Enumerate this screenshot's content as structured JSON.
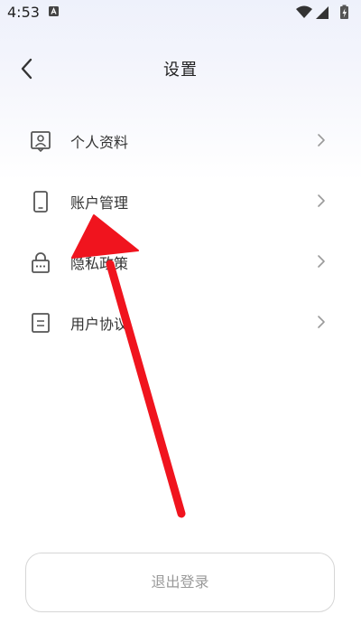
{
  "status_bar": {
    "time": "4:53",
    "icons": [
      "accessibility-notification-icon",
      "wifi-icon",
      "signal-icon",
      "battery-charging-icon"
    ]
  },
  "header": {
    "title": "设置",
    "back_icon": "chevron-left-icon"
  },
  "menu": {
    "items": [
      {
        "label": "个人资料",
        "icon": "profile-card-icon"
      },
      {
        "label": "账户管理",
        "icon": "phone-account-icon"
      },
      {
        "label": "隐私政策",
        "icon": "lock-icon"
      },
      {
        "label": "用户协议",
        "icon": "document-icon"
      }
    ],
    "chevron_icon": "chevron-right-icon"
  },
  "logout": {
    "label": "退出登录"
  },
  "annotation": {
    "color": "#f0141e"
  },
  "colors": {
    "icon": "#555555",
    "chevron": "#9a9a9a",
    "button_border": "#d6d6d6",
    "button_text": "#9a9a9a"
  }
}
